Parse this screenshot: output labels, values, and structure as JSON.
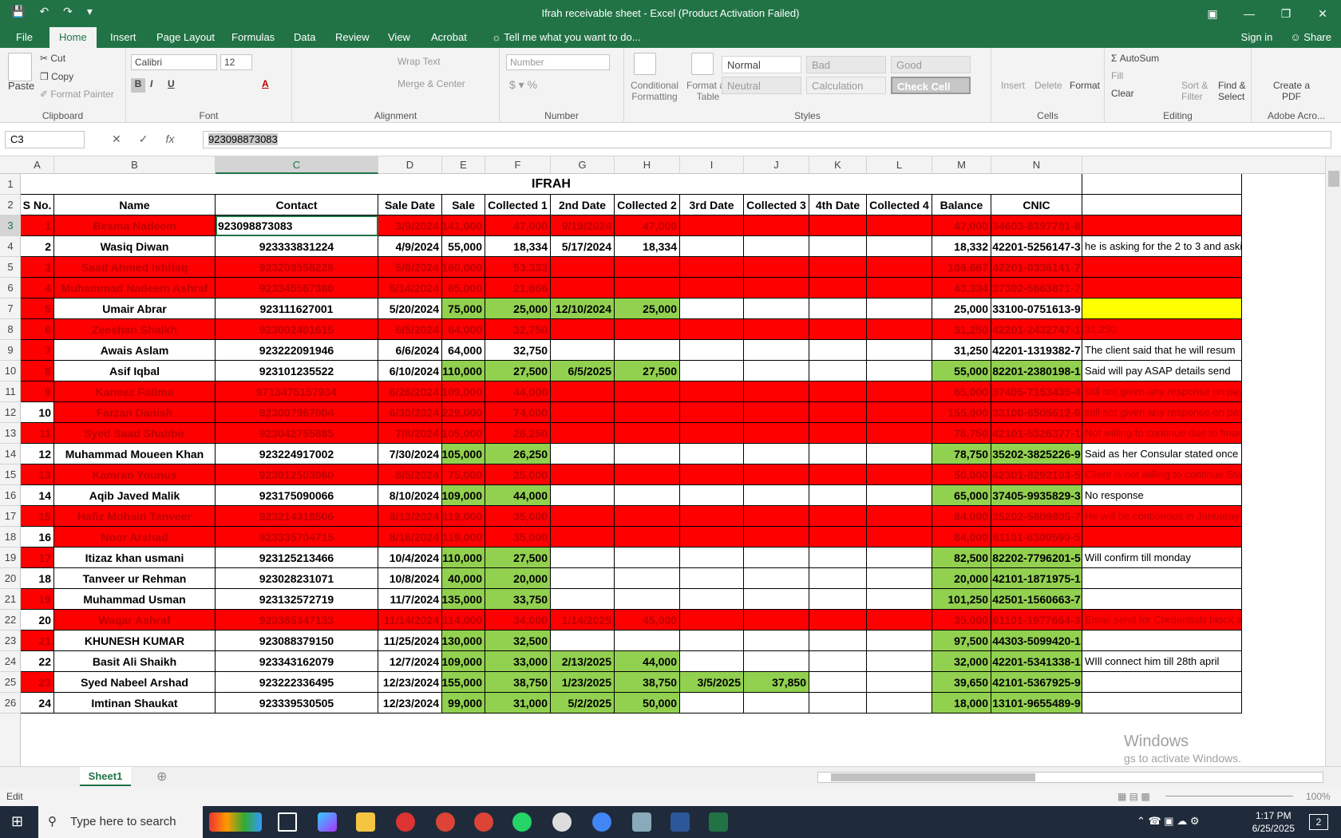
{
  "window": {
    "title": "Ifrah receivable sheet - Excel (Product Activation Failed)"
  },
  "tabs": [
    "File",
    "Home",
    "Insert",
    "Page Layout",
    "Formulas",
    "Data",
    "Review",
    "View",
    "Acrobat"
  ],
  "tell_me": "Tell me what you want to do...",
  "sign_in": "Sign in",
  "share": "Share",
  "ribbon": {
    "clipboard": {
      "paste": "Paste",
      "cut": "Cut",
      "copy": "Copy",
      "format_painter": "Format Painter",
      "label": "Clipboard"
    },
    "font": {
      "name": "Calibri",
      "size": "12",
      "label": "Font"
    },
    "alignment": {
      "wrap": "Wrap Text",
      "merge": "Merge & Center",
      "label": "Alignment"
    },
    "number": {
      "format": "Number",
      "label": "Number"
    },
    "styles": {
      "conditional": "Conditional Formatting",
      "format_table": "Format as Table",
      "normal": "Normal",
      "bad": "Bad",
      "good": "Good",
      "neutral": "Neutral",
      "calculation": "Calculation",
      "check_cell": "Check Cell",
      "label": "Styles"
    },
    "cells": {
      "insert": "Insert",
      "delete": "Delete",
      "format": "Format",
      "label": "Cells"
    },
    "editing": {
      "autosum": "AutoSum",
      "fill": "Fill",
      "clear": "Clear",
      "sort": "Sort & Filter",
      "find": "Find & Select",
      "label": "Editing"
    },
    "acrobat": {
      "create": "Create a PDF",
      "label": "Adobe Acro..."
    }
  },
  "formula_bar": {
    "name_box": "C3",
    "value": "923098873083"
  },
  "columns": [
    "A",
    "B",
    "C",
    "D",
    "E",
    "F",
    "G",
    "H",
    "I",
    "J",
    "K",
    "L",
    "M",
    "N"
  ],
  "rows": [
    "1",
    "2",
    "3",
    "4",
    "5",
    "6",
    "7",
    "8",
    "9",
    "10",
    "11",
    "12",
    "13",
    "14",
    "15",
    "16",
    "17",
    "18",
    "19",
    "20",
    "21",
    "22",
    "23",
    "24",
    "25",
    "26"
  ],
  "sheet": {
    "title": "IFRAH",
    "headers": [
      "S No.",
      "Name",
      "Contact",
      "Sale Date",
      "Sale",
      "Collected 1",
      "2nd Date",
      "Collected 2",
      "3rd Date",
      "Collected 3",
      "4th Date",
      "Collected 4",
      "Balance",
      "CNIC",
      ""
    ],
    "data": [
      {
        "c": [
          "1",
          "Besma Nadeem",
          "923098873083",
          "3/9/2024",
          "141,000",
          "47,000",
          "9/19/2024",
          "47,000",
          "",
          "",
          "",
          "",
          "47,000",
          "34603-8397781-8",
          ""
        ],
        "fill": [
          "r",
          "r",
          "",
          "r",
          "r",
          "r",
          "r",
          "r",
          "r",
          "r",
          "r",
          "r",
          "r",
          "r",
          "r"
        ]
      },
      {
        "c": [
          "2",
          "Wasiq Diwan",
          "923333831224",
          "4/9/2024",
          "55,000",
          "18,334",
          "5/17/2024",
          "18,334",
          "",
          "",
          "",
          "",
          "18,332",
          "42201-5256147-3",
          "he is asking for the 2 to 3 and aski"
        ],
        "fill": [
          "",
          "",
          "",
          "",
          "",
          "",
          "",
          "",
          "",
          "",
          "",
          "",
          "",
          "",
          ""
        ]
      },
      {
        "c": [
          "3",
          "Saad Ahmed Ishtiaq",
          "923208558228",
          "5/8/2024",
          "160,000",
          "53,333",
          "",
          "",
          "",
          "",
          "",
          "",
          "106,667",
          "42201-0336141-7",
          ""
        ],
        "fill": [
          "r",
          "r",
          "r",
          "r",
          "r",
          "r",
          "r",
          "r",
          "r",
          "r",
          "r",
          "r",
          "r",
          "r",
          "r"
        ]
      },
      {
        "c": [
          "4",
          "Muhammad Nadeem Ashraf",
          "923345567380",
          "5/14/2024",
          "65,000",
          "21,666",
          "",
          "",
          "",
          "",
          "",
          "",
          "43,334",
          "37302-5663871-7",
          ""
        ],
        "fill": [
          "r",
          "r",
          "r",
          "r",
          "r",
          "r",
          "r",
          "r",
          "r",
          "r",
          "r",
          "r",
          "r",
          "r",
          "r"
        ]
      },
      {
        "c": [
          "5",
          "Umair Abrar",
          "923111627001",
          "5/20/2024",
          "75,000",
          "25,000",
          "12/10/2024",
          "25,000",
          "",
          "",
          "",
          "",
          "25,000",
          "33100-0751613-9",
          ""
        ],
        "fill": [
          "r",
          "",
          "",
          "",
          "g",
          "g",
          "g",
          "g",
          "",
          "",
          "",
          "",
          "",
          "",
          "y"
        ]
      },
      {
        "c": [
          "6",
          "Zeeshan Shaikh",
          "923002401615",
          "6/5/2024",
          "64,000",
          "32,750",
          "",
          "",
          "",
          "",
          "",
          "",
          "31,250",
          "42201-2432747-1",
          "31,250"
        ],
        "fill": [
          "r",
          "r",
          "r",
          "r",
          "r",
          "r",
          "r",
          "r",
          "r",
          "r",
          "r",
          "r",
          "r",
          "r",
          "r"
        ]
      },
      {
        "c": [
          "7",
          "Awais Aslam",
          "923222091946",
          "6/6/2024",
          "64,000",
          "32,750",
          "",
          "",
          "",
          "",
          "",
          "",
          "31,250",
          "42201-1319382-7",
          "The client said that he will resum"
        ],
        "fill": [
          "r",
          "",
          "",
          "",
          "",
          "",
          "",
          "",
          "",
          "",
          "",
          "",
          "",
          "",
          ""
        ]
      },
      {
        "c": [
          "8",
          "Asif Iqbal",
          "923101235522",
          "6/10/2024",
          "110,000",
          "27,500",
          "6/5/2025",
          "27,500",
          "",
          "",
          "",
          "",
          "55,000",
          "82201-2380198-1",
          "Said will pay ASAP details send"
        ],
        "fill": [
          "r",
          "",
          "",
          "",
          "g",
          "g",
          "g",
          "g",
          "",
          "",
          "",
          "",
          "g",
          "g",
          ""
        ]
      },
      {
        "c": [
          "9",
          "Kaneez Fatima",
          "9713475157934",
          "6/26/2024",
          "109,000",
          "44,000",
          "",
          "",
          "",
          "",
          "",
          "",
          "65,000",
          "37405-7153435-4",
          "still not given any response on pay"
        ],
        "fill": [
          "r",
          "r",
          "r",
          "r",
          "r",
          "r",
          "r",
          "r",
          "r",
          "r",
          "r",
          "r",
          "r",
          "r",
          "r"
        ]
      },
      {
        "c": [
          "10",
          "Farzan Danish",
          "923007967004",
          "6/30/2024",
          "229,000",
          "74,000",
          "",
          "",
          "",
          "",
          "",
          "",
          "155,000",
          "33100-6505612-9",
          "still not given any response on pay"
        ],
        "fill": [
          "",
          "r",
          "r",
          "r",
          "r",
          "r",
          "r",
          "r",
          "r",
          "r",
          "r",
          "r",
          "r",
          "r",
          "r"
        ]
      },
      {
        "c": [
          "11",
          "Syed Saad Shabbir",
          "923042755885",
          "7/8/2024",
          "105,000",
          "26,250",
          "",
          "",
          "",
          "",
          "",
          "",
          "78,750",
          "42101-5326377-1",
          "Not willing to continue due to finan"
        ],
        "fill": [
          "r",
          "r",
          "r",
          "r",
          "r",
          "r",
          "r",
          "r",
          "r",
          "r",
          "r",
          "r",
          "r",
          "r",
          "r"
        ]
      },
      {
        "c": [
          "12",
          "Muhammad Moueen Khan",
          "923224917002",
          "7/30/2024",
          "105,000",
          "26,250",
          "",
          "",
          "",
          "",
          "",
          "",
          "78,750",
          "35202-3825226-9",
          "Said as her Consular stated once y"
        ],
        "fill": [
          "",
          "",
          "",
          "",
          "g",
          "g",
          "",
          "",
          "",
          "",
          "",
          "",
          "g",
          "g",
          ""
        ]
      },
      {
        "c": [
          "13",
          "Kamran Younus",
          "923012503060",
          "8/5/2024",
          "75,000",
          "25,000",
          "",
          "",
          "",
          "",
          "",
          "",
          "50,000",
          "42301-8292103-5",
          "Client is not willing to continue Stat"
        ],
        "fill": [
          "r",
          "r",
          "r",
          "r",
          "r",
          "r",
          "r",
          "r",
          "r",
          "r",
          "r",
          "r",
          "r",
          "r",
          "r"
        ]
      },
      {
        "c": [
          "14",
          "Aqib Javed Malik",
          "923175090066",
          "8/10/2024",
          "109,000",
          "44,000",
          "",
          "",
          "",
          "",
          "",
          "",
          "65,000",
          "37405-9935829-3",
          "No response"
        ],
        "fill": [
          "",
          "",
          "",
          "",
          "g",
          "g",
          "",
          "",
          "",
          "",
          "",
          "",
          "g",
          "g",
          ""
        ]
      },
      {
        "c": [
          "15",
          "Hafiz Mohsin Tanveer",
          "923214318506",
          "8/13/2024",
          "119,000",
          "35,000",
          "",
          "",
          "",
          "",
          "",
          "",
          "84,000",
          "35202-5809805-7",
          "He will be contionous in Januaray"
        ],
        "fill": [
          "r",
          "r",
          "r",
          "r",
          "r",
          "r",
          "r",
          "r",
          "r",
          "r",
          "r",
          "r",
          "r",
          "r",
          "r"
        ]
      },
      {
        "c": [
          "16",
          "Noor Arshad",
          "923335704715",
          "8/16/2024",
          "119,000",
          "35,000",
          "",
          "",
          "",
          "",
          "",
          "",
          "84,000",
          "61101-6300590-5",
          ""
        ],
        "fill": [
          "",
          "r",
          "r",
          "r",
          "r",
          "r",
          "r",
          "r",
          "r",
          "r",
          "r",
          "r",
          "r",
          "r",
          "r"
        ]
      },
      {
        "c": [
          "17",
          "Itizaz khan usmani",
          "923125213466",
          "10/4/2024",
          "110,000",
          "27,500",
          "",
          "",
          "",
          "",
          "",
          "",
          "82,500",
          "82202-7796201-5",
          "Will confirm till monday"
        ],
        "fill": [
          "r",
          "",
          "",
          "",
          "g",
          "g",
          "",
          "",
          "",
          "",
          "",
          "",
          "g",
          "g",
          ""
        ]
      },
      {
        "c": [
          "18",
          "Tanveer ur Rehman",
          "923028231071",
          "10/8/2024",
          "40,000",
          "20,000",
          "",
          "",
          "",
          "",
          "",
          "",
          "20,000",
          "42101-1871975-1",
          ""
        ],
        "fill": [
          "",
          "",
          "",
          "",
          "g",
          "g",
          "",
          "",
          "",
          "",
          "",
          "",
          "g",
          "g",
          ""
        ]
      },
      {
        "c": [
          "19",
          "Muhammad Usman",
          "923132572719",
          "11/7/2024",
          "135,000",
          "33,750",
          "",
          "",
          "",
          "",
          "",
          "",
          "101,250",
          "42501-1560663-7",
          ""
        ],
        "fill": [
          "r",
          "",
          "",
          "",
          "g",
          "g",
          "",
          "",
          "",
          "",
          "",
          "",
          "g",
          "g",
          ""
        ]
      },
      {
        "c": [
          "20",
          "Waqar Ashraf",
          "923365347133",
          "11/14/2024",
          "114,000",
          "34,000",
          "1/14/2025",
          "45,000",
          "",
          "",
          "",
          "",
          "35,000",
          "61101-1977664-3",
          "Email send for Credentials block as"
        ],
        "fill": [
          "",
          "r",
          "r",
          "r",
          "r",
          "r",
          "r",
          "r",
          "r",
          "r",
          "r",
          "r",
          "r",
          "r",
          "r"
        ]
      },
      {
        "c": [
          "21",
          "KHUNESH KUMAR",
          "923088379150",
          "11/25/2024",
          "130,000",
          "32,500",
          "",
          "",
          "",
          "",
          "",
          "",
          "97,500",
          "44303-5099420-1",
          ""
        ],
        "fill": [
          "r",
          "",
          "",
          "",
          "g",
          "g",
          "",
          "",
          "",
          "",
          "",
          "",
          "g",
          "g",
          ""
        ]
      },
      {
        "c": [
          "22",
          "Basit Ali Shaikh",
          "923343162079",
          "12/7/2024",
          "109,000",
          "33,000",
          "2/13/2025",
          "44,000",
          "",
          "",
          "",
          "",
          "32,000",
          "42201-5341338-1",
          "WIll connect him till 28th april"
        ],
        "fill": [
          "",
          "",
          "",
          "",
          "g",
          "g",
          "g",
          "g",
          "",
          "",
          "",
          "",
          "g",
          "g",
          ""
        ]
      },
      {
        "c": [
          "23",
          "Syed Nabeel Arshad",
          "923222336495",
          "12/23/2024",
          "155,000",
          "38,750",
          "1/23/2025",
          "38,750",
          "3/5/2025",
          "37,850",
          "",
          "",
          "39,650",
          "42101-5367925-9",
          ""
        ],
        "fill": [
          "r",
          "",
          "",
          "",
          "g",
          "g",
          "g",
          "g",
          "g",
          "g",
          "",
          "",
          "g",
          "g",
          ""
        ]
      },
      {
        "c": [
          "24",
          "Imtinan Shaukat",
          "923339530505",
          "12/23/2024",
          "99,000",
          "31,000",
          "5/2/2025",
          "50,000",
          "",
          "",
          "",
          "",
          "18,000",
          "13101-9655489-9",
          ""
        ],
        "fill": [
          "",
          "",
          "",
          "",
          "g",
          "g",
          "g",
          "g",
          "",
          "",
          "",
          "",
          "g",
          "g",
          ""
        ]
      }
    ]
  },
  "watermark": {
    "line1": "Windows",
    "line2": "gs to activate Windows."
  },
  "sheet_tab": "Sheet1",
  "status": {
    "mode": "Edit",
    "zoom": "100%"
  },
  "taskbar": {
    "search": "Type here to search",
    "time": "1:17 PM",
    "date": "6/25/2025",
    "notif": "2"
  },
  "colors": {
    "excel_green": "#217346",
    "red_fill": "#ff0000",
    "green_fill": "#92d050",
    "yellow_fill": "#ffff00",
    "red_text": "#c00000"
  }
}
